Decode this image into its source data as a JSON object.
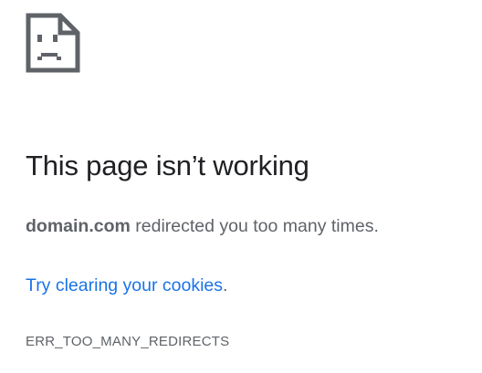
{
  "icon": "sad-page-icon",
  "title": "This page isn’t working",
  "message": {
    "domain": "domain.com",
    "text": " redirected you too many times."
  },
  "suggestion": {
    "link_label": "Try clearing your cookies",
    "trailing": "."
  },
  "error_code": "ERR_TOO_MANY_REDIRECTS",
  "colors": {
    "title": "#202124",
    "body_text": "#5f6368",
    "link": "#1a73e8",
    "icon": "#5f6368"
  }
}
